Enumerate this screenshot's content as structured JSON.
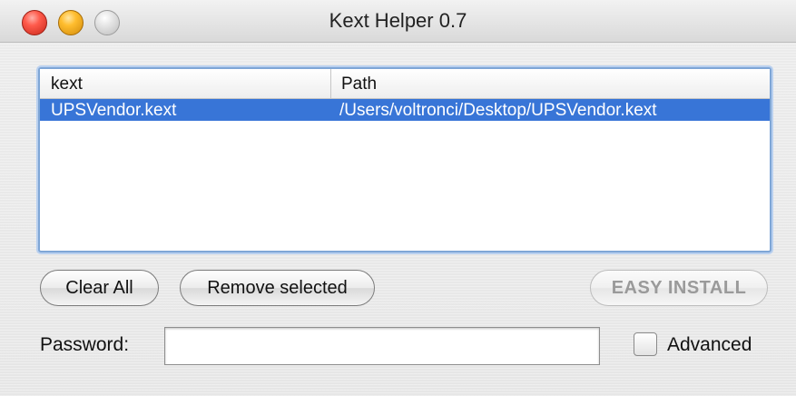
{
  "window": {
    "title": "Kext Helper 0.7"
  },
  "table": {
    "columns": [
      "kext",
      "Path"
    ],
    "rows": [
      {
        "kext": "UPSVendor.kext",
        "path": "/Users/voltronci/Desktop/UPSVendor.kext",
        "selected": true
      }
    ]
  },
  "buttons": {
    "clear_all": "Clear All",
    "remove_selected": "Remove selected",
    "easy_install": "EASY INSTALL"
  },
  "password": {
    "label": "Password:",
    "value": ""
  },
  "advanced": {
    "label": "Advanced",
    "checked": false
  },
  "colors": {
    "selection": "#3875d7",
    "focus_ring": "#7fa6d6"
  }
}
